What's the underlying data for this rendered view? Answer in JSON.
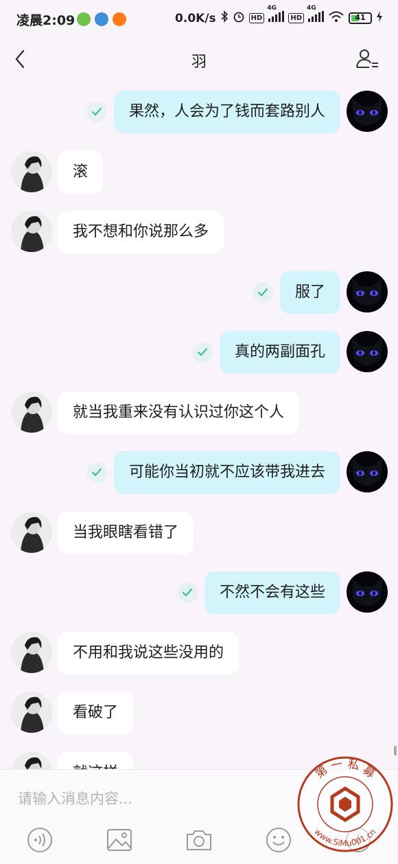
{
  "status_bar": {
    "time": "凌晨2:09",
    "network_speed": "0.0K/s",
    "hd_label": "HD",
    "net_type": "4G",
    "battery": "41",
    "battery_level": 0.41
  },
  "header": {
    "title": "羽"
  },
  "messages": [
    {
      "from": "me",
      "text": "果然，人会为了钱而套路别人"
    },
    {
      "from": "other",
      "text": "滚"
    },
    {
      "from": "other",
      "text": "我不想和你说那么多"
    },
    {
      "from": "me",
      "text": "服了"
    },
    {
      "from": "me",
      "text": "真的两副面孔"
    },
    {
      "from": "other",
      "text": "就当我重来没有认识过你这个人"
    },
    {
      "from": "me",
      "text": "可能你当初就不应该带我进去"
    },
    {
      "from": "other",
      "text": "当我眼瞎看错了"
    },
    {
      "from": "me",
      "text": "不然不会有这些"
    },
    {
      "from": "other",
      "text": "不用和我说这些没用的"
    },
    {
      "from": "other",
      "text": "看破了"
    },
    {
      "from": "other",
      "text": "就这样"
    }
  ],
  "input": {
    "placeholder": "请输入消息内容..."
  },
  "toolbar": [
    "voice-icon",
    "image-icon",
    "camera-icon",
    "emoji-icon",
    "plus-icon"
  ],
  "watermark": {
    "text_top": "第 一 私 募",
    "url": "www.SiMu001.cn"
  },
  "colors": {
    "my_bubble": "#d2f5fb",
    "other_bubble": "#ffffff",
    "background": "#f8f4fa",
    "watermark": "#b33b1e",
    "check": "#3cbfa6"
  }
}
